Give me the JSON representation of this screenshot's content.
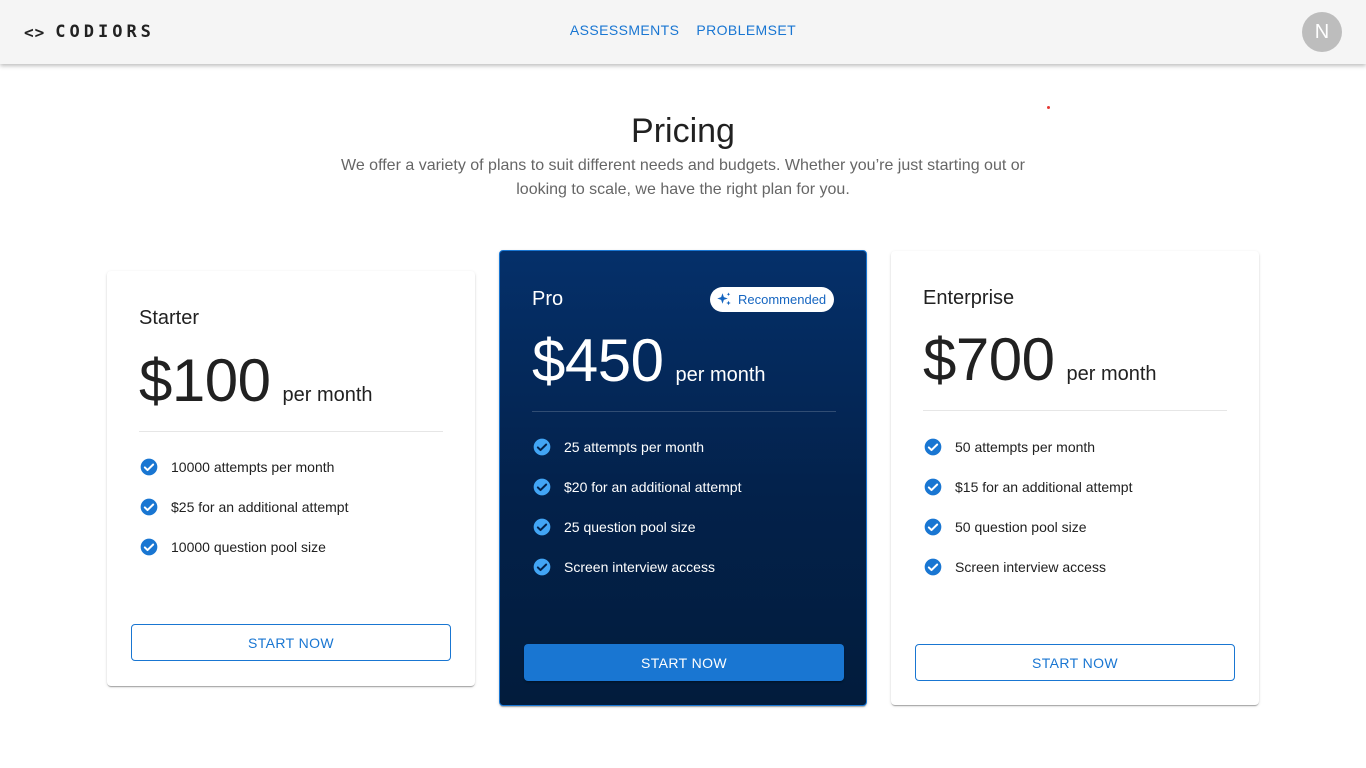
{
  "header": {
    "brand_icon": "<>",
    "brand_name": "CODIORS",
    "nav": [
      "ASSESSMENTS",
      "PROBLEMSET"
    ],
    "avatar_initial": "N"
  },
  "hero": {
    "title": "Pricing",
    "subtitle": "We offer a variety of plans to suit different needs and budgets. Whether you’re just starting out or looking to scale, we have the right plan for you."
  },
  "plans": [
    {
      "name": "Starter",
      "price": "$100",
      "period": "per month",
      "features": [
        "10000 attempts per month",
        "$25 for an additional attempt",
        "10000 question pool size"
      ],
      "cta": "START NOW"
    },
    {
      "name": "Pro",
      "badge": "Recommended",
      "price": "$450",
      "period": "per month",
      "features": [
        "25 attempts per month",
        "$20 for an additional attempt",
        "25 question pool size",
        "Screen interview access"
      ],
      "cta": "START NOW"
    },
    {
      "name": "Enterprise",
      "price": "$700",
      "period": "per month",
      "features": [
        "50 attempts per month",
        "$15 for an additional attempt",
        "50 question pool size",
        "Screen interview access"
      ],
      "cta": "START NOW"
    }
  ],
  "colors": {
    "primary": "#1976d2",
    "pro_card_bg": "#03214a",
    "appbar_bg": "#f5f5f5",
    "check_icon": "#1976d2",
    "check_icon_pro": "#42a5f5"
  },
  "icons": {
    "check": "check-circle-icon",
    "badge": "sparkles-icon"
  }
}
